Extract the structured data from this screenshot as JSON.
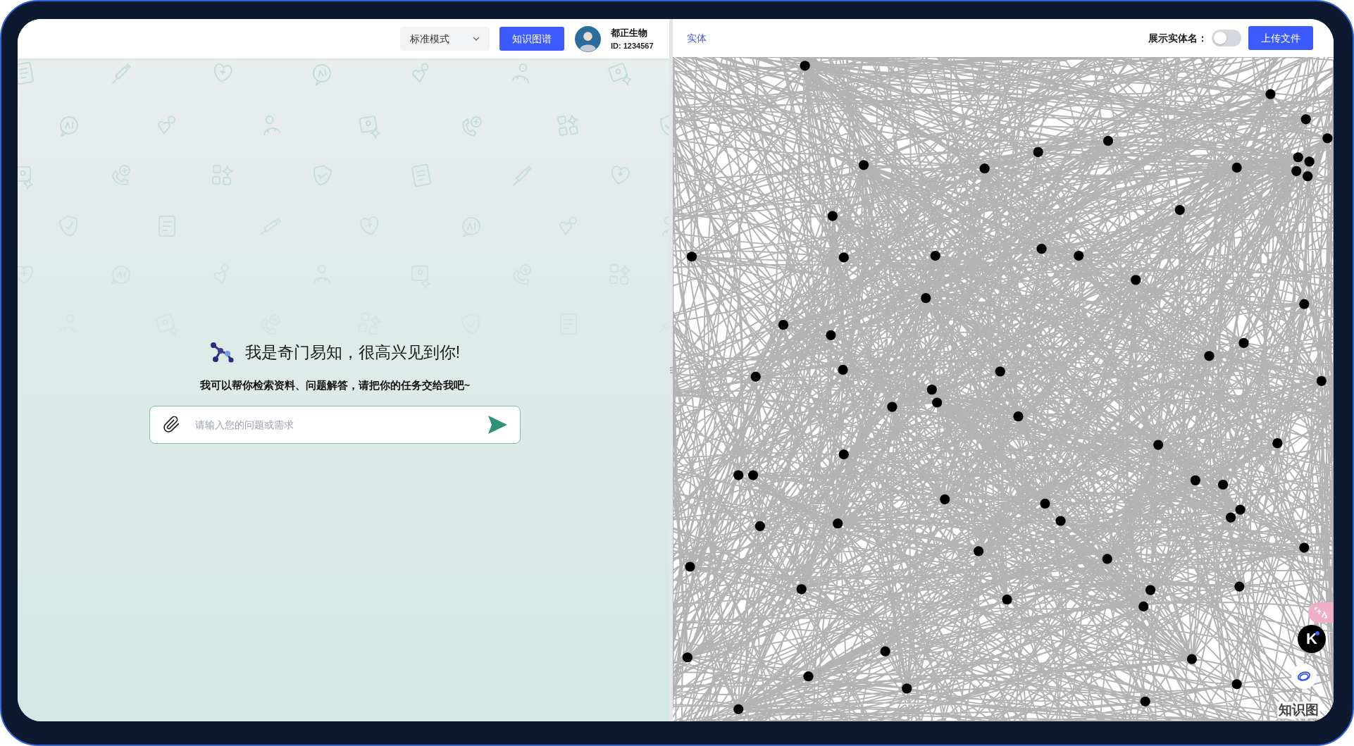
{
  "chat_header": {
    "mode_select": {
      "value": "标准模式"
    },
    "graph_button": {
      "label": "知识图谱"
    },
    "user": {
      "name": "都正生物",
      "id": "ID: 1234567"
    }
  },
  "welcome": {
    "title": "我是奇门易知，很高兴见到你!",
    "subtitle": "我可以帮你检索资料、问题解答，请把你的任务交给我吧~"
  },
  "chat_input": {
    "placeholder": "请输入您的问题或需求"
  },
  "graph_header": {
    "entity_link": "实体",
    "show_names": {
      "label": "展示实体名：",
      "on": false
    },
    "upload_button": "上传文件"
  },
  "floating_tools": {
    "assistant_badge": "K",
    "caption": "知识图"
  }
}
